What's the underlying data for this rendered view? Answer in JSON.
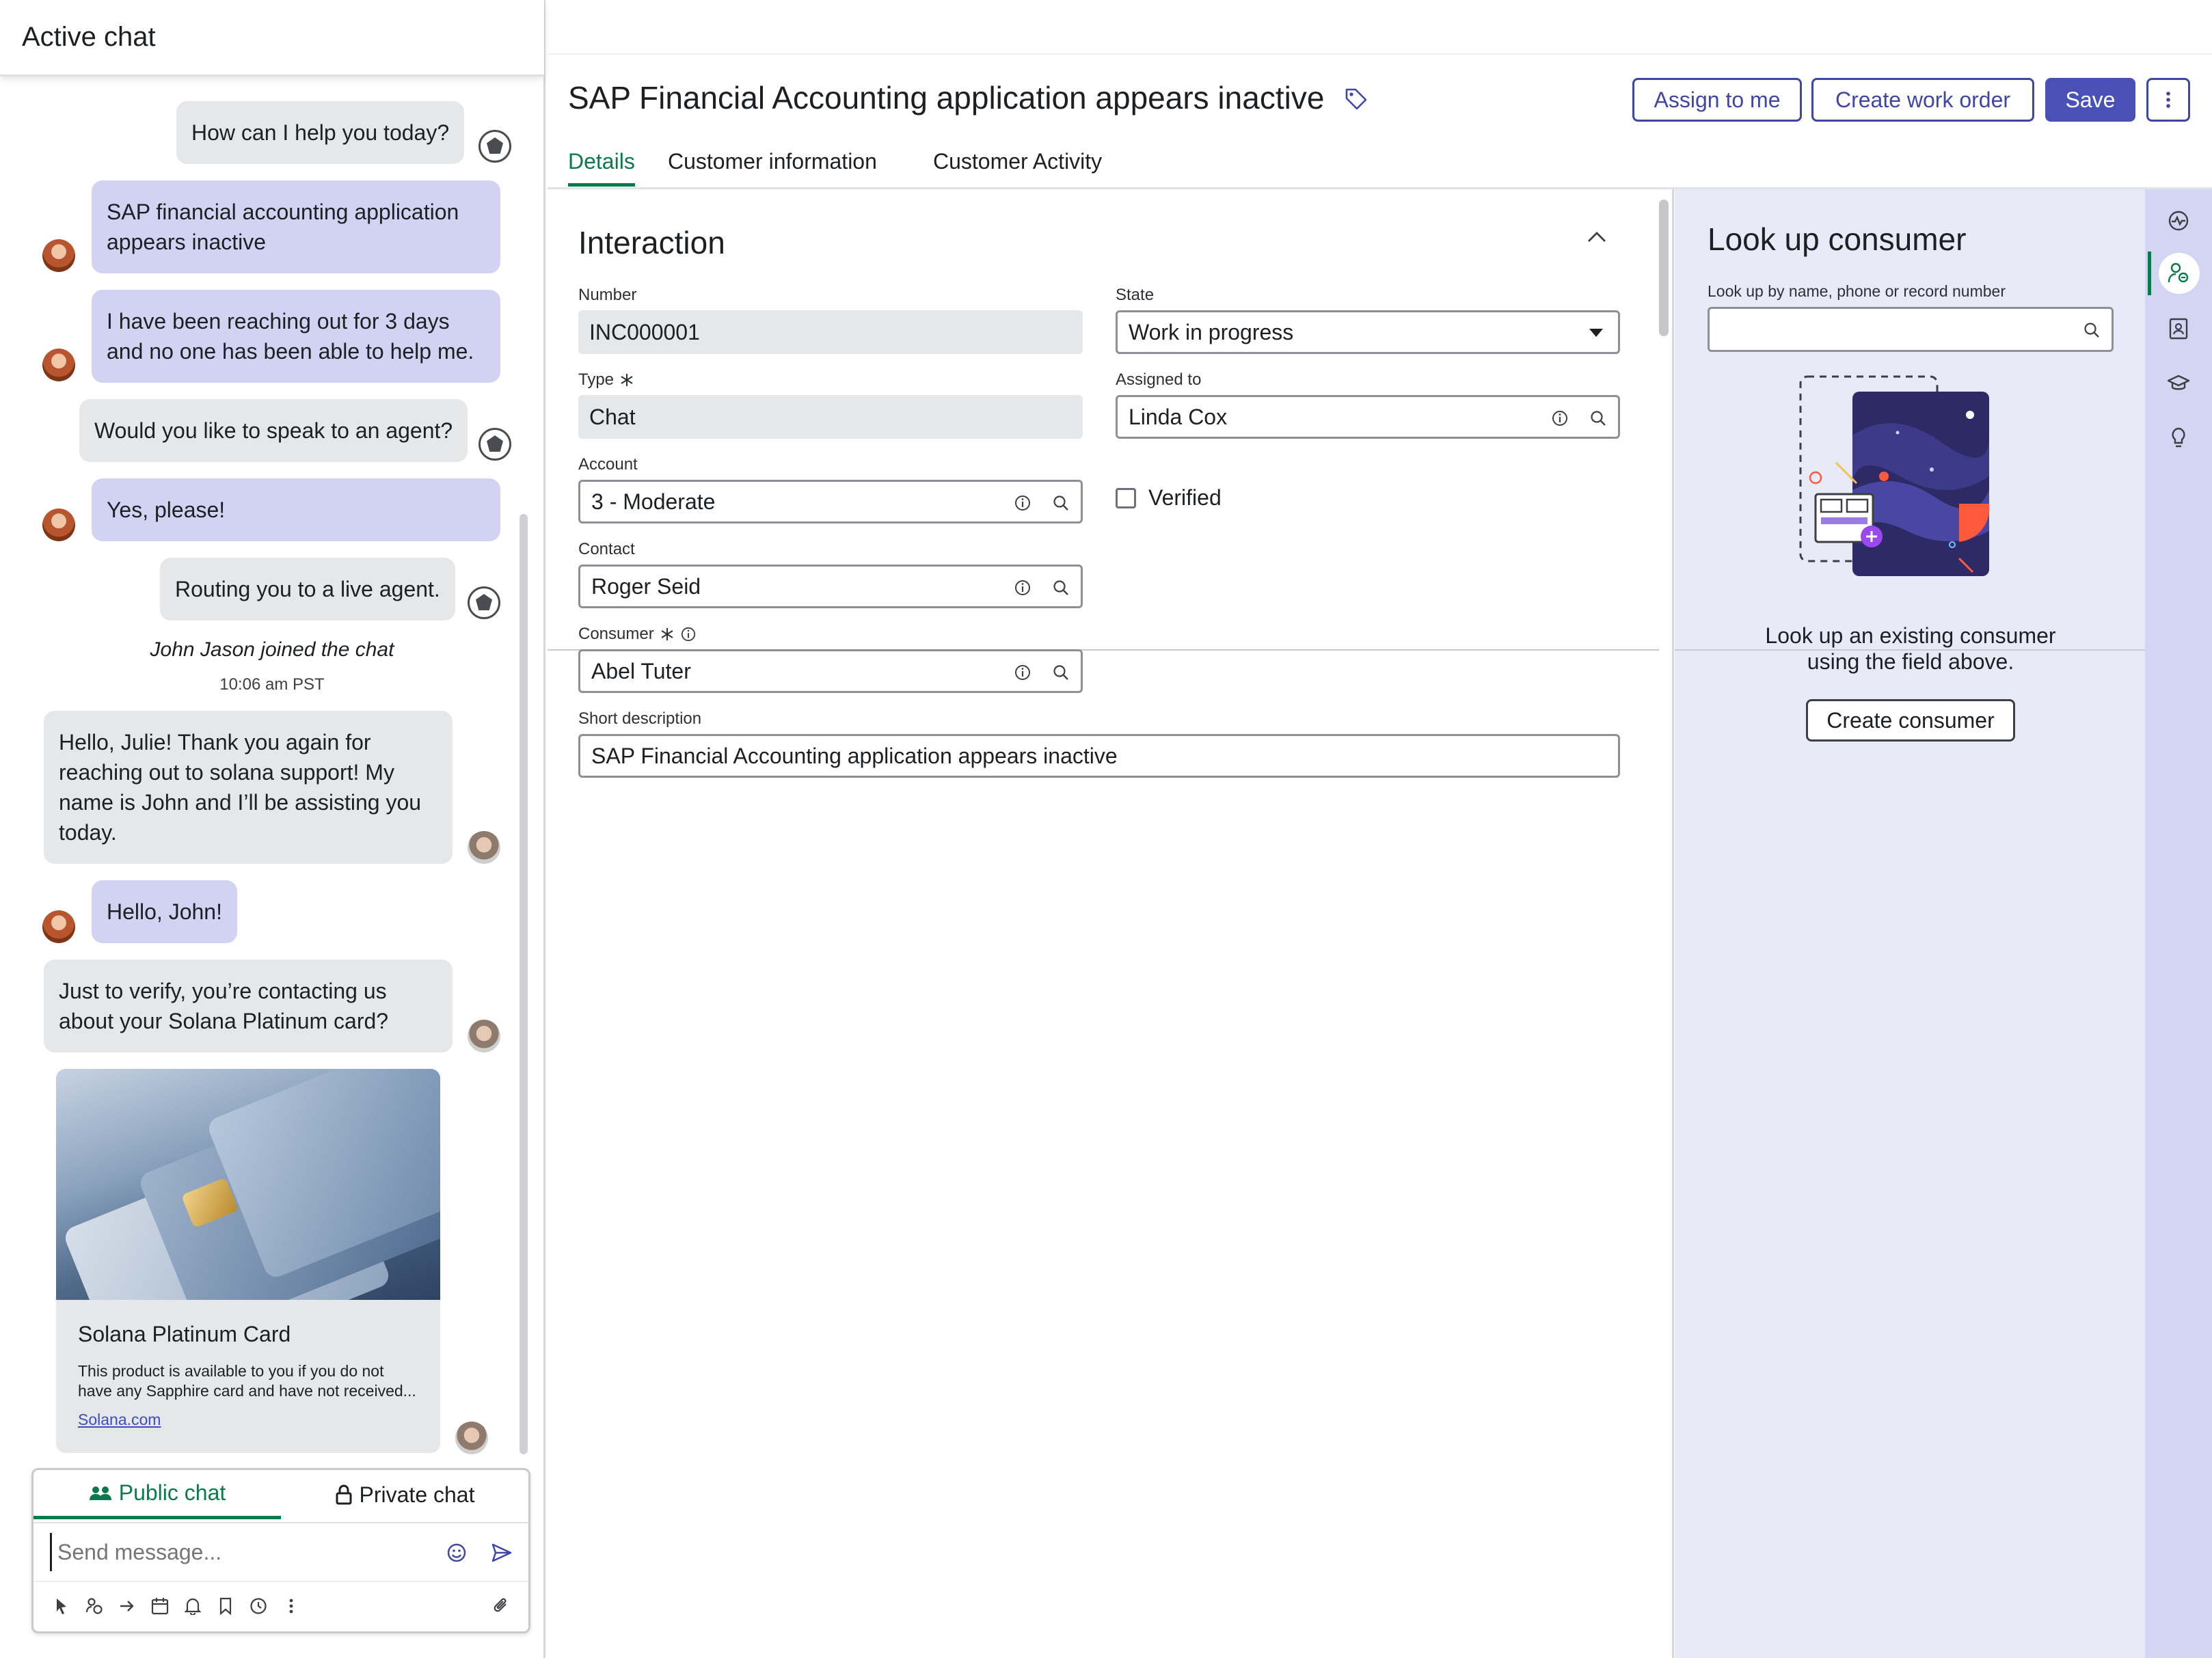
{
  "chat": {
    "header": "Active chat",
    "messages": [
      {
        "from": "system",
        "text": "How can I help you today?"
      },
      {
        "from": "customer",
        "lines": [
          "SAP financial accounting application",
          "appears inactive"
        ]
      },
      {
        "from": "customer",
        "lines": [
          "I have been reaching out for 3 days",
          "and no one has been able to help me."
        ]
      },
      {
        "from": "system",
        "text": "Would you like to speak to an agent?"
      },
      {
        "from": "customer",
        "text": "Yes, please!"
      },
      {
        "from": "system",
        "text": "Routing you to a live agent."
      }
    ],
    "joined": "John Jason joined the chat",
    "joined_time": "10:06 am PST",
    "agent_messages": [
      {
        "from": "agent",
        "lines": [
          "Hello, Julie! Thank you again for",
          "reaching out to solana support! My",
          "name is John and I’ll be assisting you",
          "today."
        ]
      },
      {
        "from": "customer",
        "text": "Hello, John!"
      },
      {
        "from": "agent",
        "lines": [
          "Just to verify, you’re contacting us",
          "about your Solana Platinum card?"
        ]
      }
    ],
    "card": {
      "title": "Solana Platinum Card",
      "description_lines": [
        "This product is available to you if you do not",
        "have any Sapphire card and have not received..."
      ],
      "link": "Solana.com"
    },
    "composer": {
      "tab_public": "Public chat",
      "tab_private": "Private chat",
      "placeholder": "Send message...",
      "tool_icons": [
        "quick-action-icon",
        "assign-icon",
        "forward-icon",
        "calendar-icon",
        "notification-icon",
        "bookmark-icon",
        "clock-icon",
        "more-icon",
        "attach-icon"
      ]
    }
  },
  "record": {
    "title": "SAP Financial Accounting application appears inactive",
    "buttons": {
      "assign": "Assign to me",
      "create_work_order": "Create work order",
      "save": "Save"
    },
    "tabs": [
      "Details",
      "Customer information",
      "Customer Activity"
    ],
    "active_tab": "Details"
  },
  "form": {
    "section": "Interaction",
    "fields": {
      "number": {
        "label": "Number",
        "value": "INC000001"
      },
      "state": {
        "label": "State",
        "value": "Work in progress"
      },
      "type": {
        "label": "Type",
        "value": "Chat",
        "required": true
      },
      "assigned_to": {
        "label": "Assigned to",
        "value": "Linda Cox"
      },
      "account": {
        "label": "Account",
        "value": "3 - Moderate"
      },
      "verified": {
        "label": "Verified",
        "checked": false
      },
      "contact": {
        "label": "Contact",
        "value": "Roger Seid"
      },
      "consumer": {
        "label": "Consumer",
        "value": "Abel Tuter",
        "required": true
      },
      "short_description": {
        "label": "Short description",
        "value": "SAP Financial Accounting application appears inactive"
      }
    }
  },
  "context_panel": {
    "title": "Look up consumer",
    "search_label": "Look up by name, phone or record number",
    "message_lines": [
      "Look up an existing consumer",
      "using the field above."
    ],
    "create_button": "Create consumer",
    "rail_icons": [
      "activity-icon",
      "consumer-lookup-icon",
      "contact-card-icon",
      "knowledge-icon",
      "lightbulb-icon"
    ],
    "active_rail": "consumer-lookup-icon"
  },
  "colors": {
    "accent_green": "#0b7a4a",
    "primary_button": "#4a51b6",
    "customer_bubble": "#d2d3f3",
    "system_bubble": "#e6e7e9",
    "context_bg": "#e9eaf8"
  }
}
